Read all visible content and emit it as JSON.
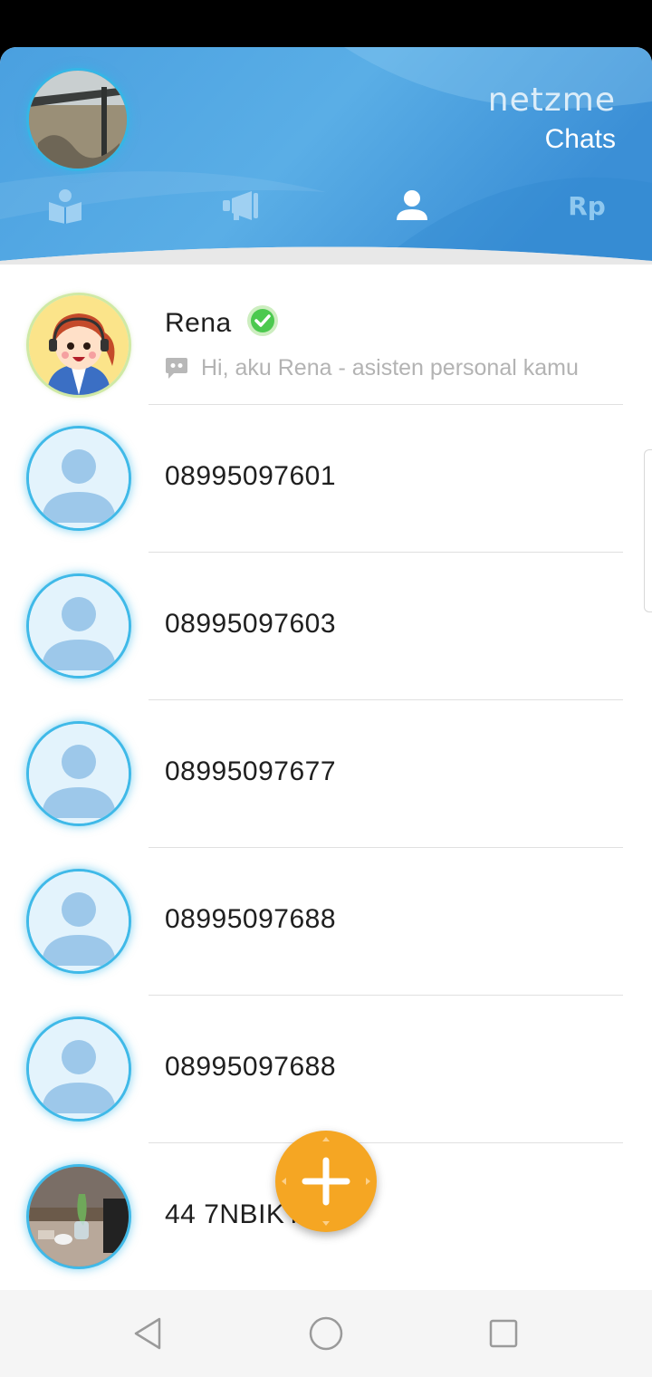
{
  "header": {
    "brand": "netzme",
    "title": "Chats",
    "tabs": [
      {
        "icon": "book-reader-icon"
      },
      {
        "icon": "megaphone-icon"
      },
      {
        "icon": "person-icon",
        "active": true
      },
      {
        "label": "Rp"
      }
    ]
  },
  "contacts": [
    {
      "name": "Rena",
      "verified": true,
      "preview": "Hi, aku Rena - asisten personal kamu",
      "avatar": "rena-cartoon-avatar"
    },
    {
      "name": "08995097601",
      "avatar": "default-avatar"
    },
    {
      "name": "08995097603",
      "avatar": "default-avatar"
    },
    {
      "name": "08995097677",
      "avatar": "default-avatar"
    },
    {
      "name": "08995097688",
      "avatar": "default-avatar"
    },
    {
      "name": "08995097688",
      "avatar": "default-avatar"
    },
    {
      "name": "44 7NBIKY17",
      "avatar": "photo-avatar"
    }
  ],
  "colors": {
    "header_blue": "#3d96dc",
    "accent_orange": "#f5a623",
    "avatar_ring": "#3fb9e8",
    "verified_green": "#4cc94f"
  },
  "system_nav": [
    "back-icon",
    "home-icon",
    "recents-icon"
  ]
}
